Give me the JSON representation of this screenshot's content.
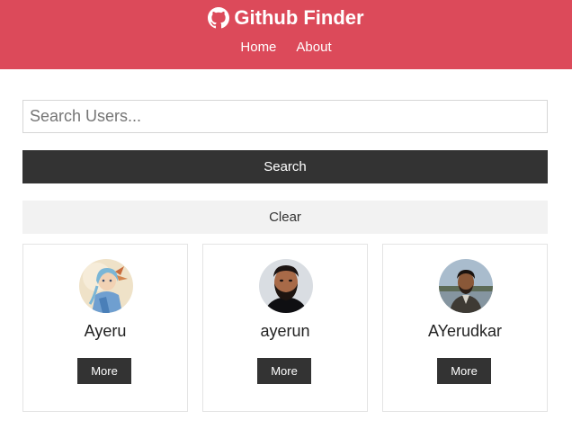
{
  "app": {
    "title": "Github Finder",
    "brand_icon": "github-icon"
  },
  "nav": {
    "links": [
      {
        "label": "Home"
      },
      {
        "label": "About"
      }
    ]
  },
  "search": {
    "value": "",
    "placeholder": "Search Users...",
    "submit_label": "Search",
    "clear_label": "Clear"
  },
  "users": [
    {
      "login": "Ayeru",
      "more_label": "More",
      "avatar": "anime-illustration-avatar"
    },
    {
      "login": "ayerun",
      "more_label": "More",
      "avatar": "bearded-man-photo-avatar"
    },
    {
      "login": "AYerudkar",
      "more_label": "More",
      "avatar": "man-outdoors-photo-avatar"
    }
  ],
  "colors": {
    "navbar": "#dc4a5a",
    "dark_button": "#333333",
    "light_button": "#f2f2f2"
  }
}
